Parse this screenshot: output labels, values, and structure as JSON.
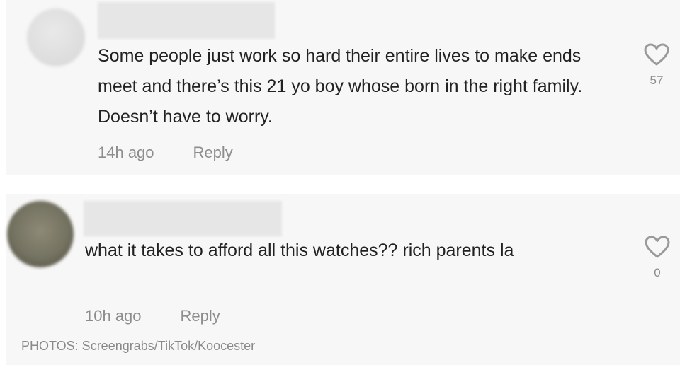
{
  "comments": [
    {
      "text": "Some people just work so hard their entire lives to make ends meet and there’s this 21 yo boy whose born in the right family. Doesn’t have to worry.",
      "time": "14h ago",
      "reply_label": "Reply",
      "likes": "57",
      "like_icon": "heart-outline-icon"
    },
    {
      "text": "what it takes to afford all this watches?? rich parents la",
      "time": "10h ago",
      "reply_label": "Reply",
      "likes": "0",
      "like_icon": "heart-outline-icon"
    }
  ],
  "credit": "PHOTOS: Screengrabs/TikTok/Koocester",
  "colors": {
    "card_bg": "#f7f7f7",
    "text": "#222222",
    "muted": "#8d8d8d"
  }
}
